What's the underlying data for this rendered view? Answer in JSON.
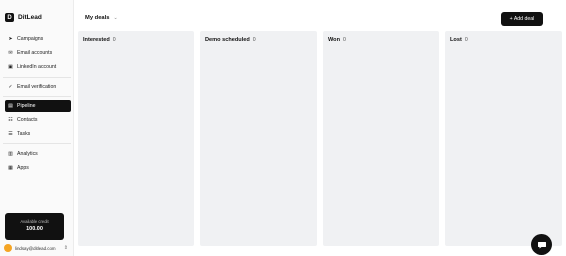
{
  "app": {
    "logo_letter": "D",
    "name": "DitLead"
  },
  "sidebar": {
    "items": [
      {
        "label": "Campaigns",
        "icon": "send-icon"
      },
      {
        "label": "Email accounts",
        "icon": "mail-icon"
      },
      {
        "label": "LinkedIn account",
        "icon": "linkedin-icon"
      },
      {
        "label": "Email verification",
        "icon": "check-circle-icon"
      },
      {
        "label": "Pipeline",
        "icon": "kanban-icon",
        "active": true
      },
      {
        "label": "Contacts",
        "icon": "contacts-icon"
      },
      {
        "label": "Tasks",
        "icon": "tasks-icon"
      },
      {
        "label": "Analytics",
        "icon": "chart-icon"
      },
      {
        "label": "Apps",
        "icon": "grid-icon"
      }
    ],
    "credits": {
      "label": "Available credit",
      "value": "100.00"
    },
    "user": {
      "email": "lindsay@ditlead.com"
    }
  },
  "header": {
    "view_label": "My deals",
    "add_button_label": "+ Add deal"
  },
  "pipeline": {
    "columns": [
      {
        "title": "Interested",
        "count": "0"
      },
      {
        "title": "Demo scheduled",
        "count": "0"
      },
      {
        "title": "Won",
        "count": "0"
      },
      {
        "title": "Lost",
        "count": "0"
      }
    ]
  },
  "colors": {
    "primary": "#111111",
    "column_bg": "#f0f1f3",
    "avatar": "#f5a524"
  }
}
